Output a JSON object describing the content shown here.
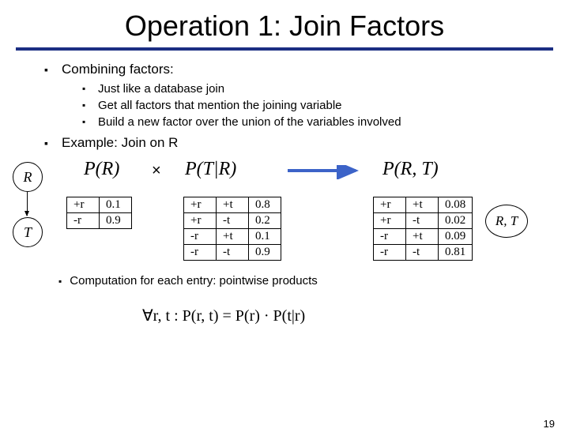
{
  "title": "Operation 1: Join Factors",
  "bullets": {
    "combining": "Combining factors:",
    "sub1": "Just like a database join",
    "sub2": "Get all factors that mention the joining variable",
    "sub3": "Build a new factor over the union of the variables involved",
    "example": "Example: Join on R"
  },
  "nodes": {
    "R": "R",
    "T": "T",
    "RT": "R, T"
  },
  "eq": {
    "PR": "P(R)",
    "times": "×",
    "PTR": "P(T|R)",
    "PRT": "P(R, T)"
  },
  "tableR": {
    "r0c0": "+r",
    "r0c1": "0.1",
    "r1c0": "-r",
    "r1c1": "0.9"
  },
  "tableTR": {
    "r0c0": "+r",
    "r0c1": "+t",
    "r0c2": "0.8",
    "r1c0": "+r",
    "r1c1": "-t",
    "r1c2": "0.2",
    "r2c0": "-r",
    "r2c1": "+t",
    "r2c2": "0.1",
    "r3c0": "-r",
    "r3c1": "-t",
    "r3c2": "0.9"
  },
  "tableRT": {
    "r0c0": "+r",
    "r0c1": "+t",
    "r0c2": "0.08",
    "r1c0": "+r",
    "r1c1": "-t",
    "r1c2": "0.02",
    "r2c0": "-r",
    "r2c1": "+t",
    "r2c2": "0.09",
    "r3c0": "-r",
    "r3c1": "-t",
    "r3c2": "0.81"
  },
  "footer": {
    "comp": "Computation for each entry: pointwise products",
    "formula": "∀r, t :    P(r, t) = P(r) · P(t|r)"
  },
  "pageno": "19"
}
